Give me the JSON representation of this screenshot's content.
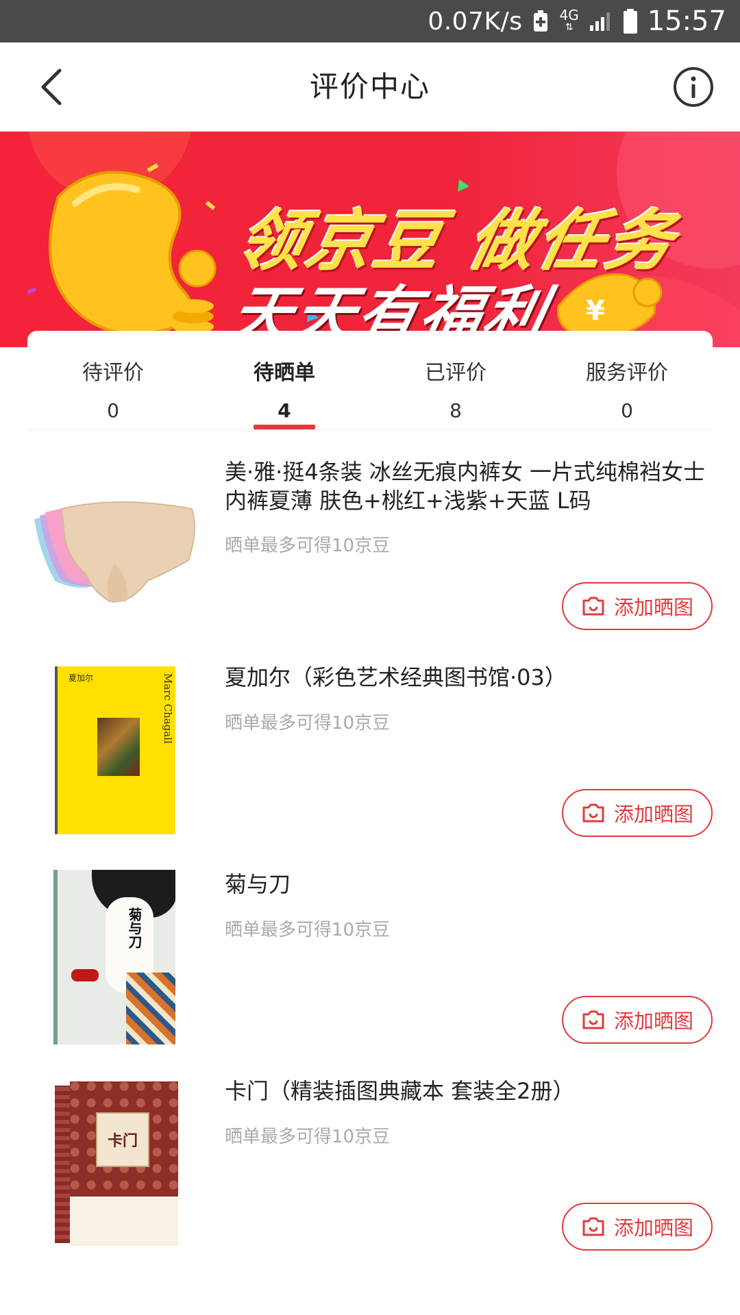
{
  "status_bar": {
    "net_speed": "0.07K/s",
    "network_type": "4G",
    "time": "15:57",
    "icons": [
      "battery-saver-icon",
      "signal-icon",
      "battery-icon"
    ]
  },
  "header": {
    "title": "评价中心",
    "back_icon": "chevron-left-icon",
    "info_icon": "info-icon"
  },
  "banner": {
    "line1": "领京豆 做任务",
    "line2": "天天有福利",
    "colors": {
      "background": "#f4233a",
      "headline": "#ffe14a"
    }
  },
  "tabs": [
    {
      "label": "待评价",
      "count": "0",
      "active": false
    },
    {
      "label": "待晒单",
      "count": "4",
      "active": true
    },
    {
      "label": "已评价",
      "count": "8",
      "active": false
    },
    {
      "label": "服务评价",
      "count": "0",
      "active": false
    }
  ],
  "items": [
    {
      "title": "美·雅·挺4条装 冰丝无痕内裤女 一片式纯棉裆女士内裤夏薄 肤色+桃红+浅紫+天蓝 L码",
      "hint": "晒单最多可得10京豆",
      "button": "添加晒图"
    },
    {
      "title": "夏加尔（彩色艺术经典图书馆·03）",
      "hint": "晒单最多可得10京豆",
      "button": "添加晒图",
      "cover_text": {
        "cn": "夏加尔",
        "en": "Marc Chagall"
      }
    },
    {
      "title": "菊与刀",
      "hint": "晒单最多可得10京豆",
      "button": "添加晒图",
      "cover_text": {
        "cn": "菊与刀"
      }
    },
    {
      "title": "卡门（精装插图典藏本 套装全2册）",
      "hint": "晒单最多可得10京豆",
      "button": "添加晒图",
      "cover_text": {
        "cn": "卡门"
      }
    }
  ],
  "accent_color": "#e4393c"
}
